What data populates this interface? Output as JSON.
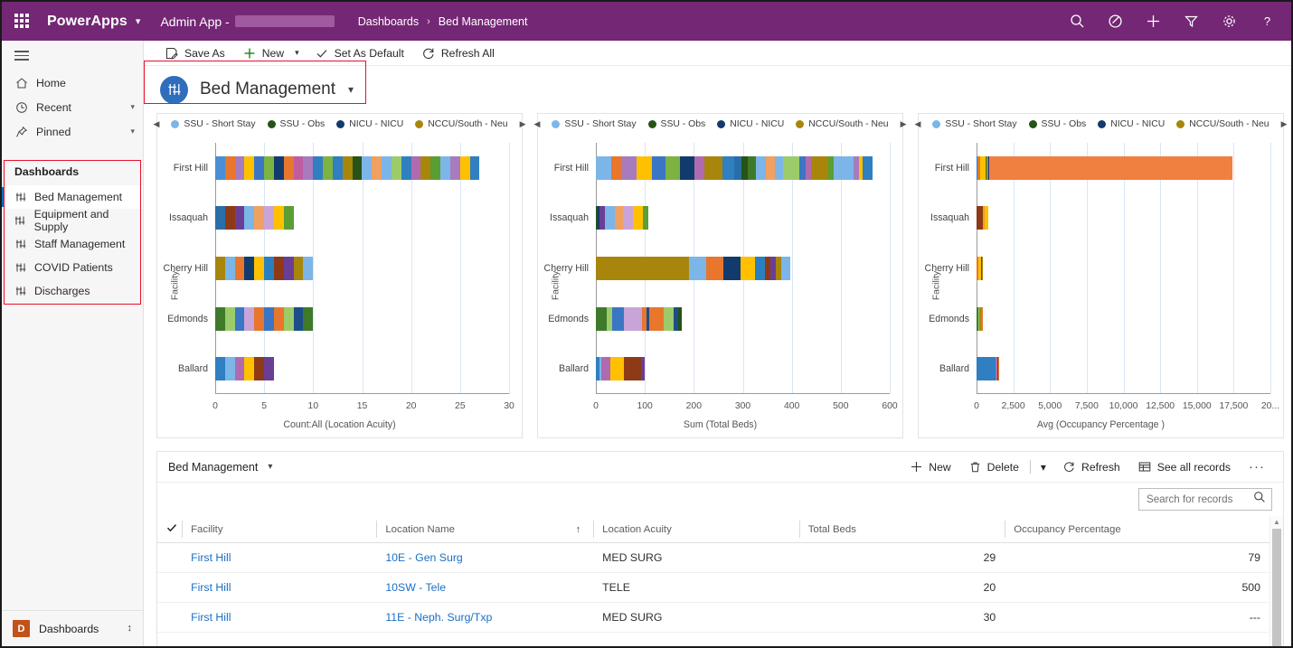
{
  "topbar": {
    "waffle_label": "app-launcher",
    "brand": "PowerApps",
    "app_name": "Admin App -",
    "breadcrumb_root": "Dashboards",
    "breadcrumb_sep": "›",
    "breadcrumb_current": "Bed Management",
    "brand_color": "#742774",
    "icons": [
      "search-icon",
      "edit-circle-icon",
      "plus-icon",
      "filter-icon",
      "gear-icon",
      "help-icon"
    ]
  },
  "commandbar": {
    "save_as": "Save As",
    "new": "New",
    "set_as_default": "Set As Default",
    "refresh_all": "Refresh All"
  },
  "sidebar": {
    "nav": [
      {
        "label": "Home",
        "icon": "home-icon",
        "chevron": false
      },
      {
        "label": "Recent",
        "icon": "clock-icon",
        "chevron": true
      },
      {
        "label": "Pinned",
        "icon": "pin-icon",
        "chevron": true
      }
    ],
    "group_title": "Dashboards",
    "dashboards": [
      {
        "label": "Bed Management",
        "active": true
      },
      {
        "label": "Equipment and Supply",
        "active": false
      },
      {
        "label": "Staff Management",
        "active": false
      },
      {
        "label": "COVID Patients",
        "active": false
      },
      {
        "label": "Discharges",
        "active": false
      }
    ],
    "footer": {
      "badge": "D",
      "label": "Dashboards"
    }
  },
  "dashboard_header": {
    "title": "Bed Management",
    "icon_color": "#2f6dbd"
  },
  "legend": {
    "prev": "◀",
    "next": "▶",
    "items": [
      {
        "label": "SSU - Short Stay",
        "color": "#7cb5e8"
      },
      {
        "label": "SSU - Obs",
        "color": "#275317"
      },
      {
        "label": "NICU - NICU",
        "color": "#123b6d"
      },
      {
        "label": "NCCU/South - Neu",
        "color": "#a8860b"
      }
    ]
  },
  "grid": {
    "title": "Bed Management",
    "toolbar": {
      "new": "New",
      "delete": "Delete",
      "refresh": "Refresh",
      "see_all_records": "See all records",
      "overflow": "···"
    },
    "search": {
      "placeholder": "Search for records",
      "value": ""
    },
    "columns": [
      {
        "label": "Facility",
        "align": "left",
        "width": "17.5%"
      },
      {
        "label": "Location Name",
        "align": "left",
        "width": "19.5%",
        "sorted": true,
        "sort_caret": "↑"
      },
      {
        "label": "Location Acuity",
        "align": "left",
        "width": "18.5%"
      },
      {
        "label": "Total Beds",
        "align": "right",
        "width": "18.5%"
      },
      {
        "label": "Occupancy Percentage",
        "align": "right",
        "width": "23.8%"
      }
    ],
    "rows": [
      {
        "facility": "First Hill",
        "location_name": "10E - Gen Surg",
        "location_acuity": "MED SURG",
        "total_beds": "29",
        "occupancy": "79"
      },
      {
        "facility": "First Hill",
        "location_name": "10SW - Tele",
        "location_acuity": "TELE",
        "total_beds": "20",
        "occupancy": "500"
      },
      {
        "facility": "First Hill",
        "location_name": "11E - Neph. Surg/Txp",
        "location_acuity": "MED SURG",
        "total_beds": "30",
        "occupancy": "---"
      }
    ]
  },
  "annotations": {
    "color": "#e8112d",
    "boxes": [
      "dashboard-title-selector",
      "sidebar-dashboards-group"
    ]
  },
  "chart_data": [
    {
      "type": "bar",
      "orientation": "horizontal",
      "stacked": true,
      "title": "",
      "xlabel": "Count:All (Location Acuity)",
      "ylabel": "Facility",
      "categories": [
        "First Hill",
        "Issaquah",
        "Cherry Hill",
        "Edmonds",
        "Ballard"
      ],
      "values": [
        27,
        8,
        10,
        10,
        6
      ],
      "xlim": [
        0,
        30
      ],
      "xticks": [
        0,
        5,
        10,
        15,
        20,
        25,
        30
      ],
      "xtick_labels": [
        "0",
        "5",
        "10",
        "15",
        "20",
        "25",
        "30"
      ],
      "grid": true,
      "legend_position": "top",
      "segments": [
        [
          [
            "#4a8fd4",
            1
          ],
          [
            "#e8762c",
            1
          ],
          [
            "#a87bbf",
            1
          ],
          [
            "#ffc000",
            1
          ],
          [
            "#3a76c4",
            1
          ],
          [
            "#7cb342",
            1
          ],
          [
            "#123b6d",
            1
          ],
          [
            "#e8762c",
            1
          ],
          [
            "#c05ca0",
            1
          ],
          [
            "#a87bbf",
            1
          ],
          [
            "#2f7fc1",
            1
          ],
          [
            "#7cb342",
            1
          ],
          [
            "#2f7fc1",
            1
          ],
          [
            "#a8860b",
            1
          ],
          [
            "#275317",
            1
          ],
          [
            "#7cb5e8",
            1
          ],
          [
            "#f0a060",
            1
          ],
          [
            "#7cb5e8",
            1
          ],
          [
            "#9ccb6a",
            1
          ],
          [
            "#2f7fc1",
            1
          ],
          [
            "#b06bb0",
            1
          ],
          [
            "#a8860b",
            1
          ],
          [
            "#5a9e34",
            1
          ],
          [
            "#7cb5e8",
            1
          ],
          [
            "#a87bbf",
            1
          ],
          [
            "#ffc000",
            1
          ],
          [
            "#2f7fc1",
            1
          ]
        ],
        [
          [
            "#2a6ea8",
            1
          ],
          [
            "#8f3a16",
            1
          ],
          [
            "#6b3e96",
            1
          ],
          [
            "#7cb5e8",
            1
          ],
          [
            "#f0a060",
            1
          ],
          [
            "#c8a4d8",
            1
          ],
          [
            "#ffc000",
            1
          ],
          [
            "#5a9e34",
            1
          ]
        ],
        [
          [
            "#a8860b",
            1
          ],
          [
            "#7cb5e8",
            1
          ],
          [
            "#e8762c",
            1
          ],
          [
            "#123b6d",
            1
          ],
          [
            "#ffc000",
            1
          ],
          [
            "#2a7fc1",
            1
          ],
          [
            "#8f3a16",
            1
          ],
          [
            "#6b3e96",
            1
          ],
          [
            "#a8860b",
            1
          ],
          [
            "#7cb5e8",
            1
          ]
        ],
        [
          [
            "#3f7a2a",
            1
          ],
          [
            "#9ccb6a",
            1
          ],
          [
            "#3a76c4",
            1
          ],
          [
            "#c8a4d8",
            1
          ],
          [
            "#e8762c",
            1
          ],
          [
            "#3a76c4",
            1
          ],
          [
            "#e8762c",
            1
          ],
          [
            "#9ccb6a",
            1
          ],
          [
            "#1c4e8a",
            1
          ],
          [
            "#3f7a2a",
            1
          ]
        ],
        [
          [
            "#2f7fc1",
            1
          ],
          [
            "#7cb5e8",
            1
          ],
          [
            "#b06bb0",
            1
          ],
          [
            "#ffc000",
            1
          ],
          [
            "#8f3a16",
            1
          ],
          [
            "#6b3e96",
            1
          ]
        ]
      ]
    },
    {
      "type": "bar",
      "orientation": "horizontal",
      "stacked": true,
      "title": "",
      "xlabel": "Sum (Total Beds)",
      "ylabel": "Facility",
      "categories": [
        "First Hill",
        "Issaquah",
        "Cherry Hill",
        "Edmonds",
        "Ballard"
      ],
      "values": [
        565,
        107,
        397,
        175,
        100
      ],
      "xlim": [
        0,
        600
      ],
      "xticks": [
        0,
        100,
        200,
        300,
        400,
        500,
        600
      ],
      "xtick_labels": [
        "0",
        "100",
        "200",
        "300",
        "400",
        "500",
        "600"
      ],
      "grid": true,
      "legend_position": "top",
      "segments": [
        [
          [
            "#7cb5e8",
            30
          ],
          [
            "#e8762c",
            22
          ],
          [
            "#a87bbf",
            28
          ],
          [
            "#ffc000",
            30
          ],
          [
            "#3a76c4",
            28
          ],
          [
            "#7cb342",
            27
          ],
          [
            "#123b6d",
            30
          ],
          [
            "#b06bb0",
            19
          ],
          [
            "#a8860b",
            36
          ],
          [
            "#2f7fc1",
            22
          ],
          [
            "#2a6ea8",
            14
          ],
          [
            "#275317",
            13
          ],
          [
            "#3f7a2a",
            16
          ],
          [
            "#7cb5e8",
            20
          ],
          [
            "#f0a060",
            18
          ],
          [
            "#7cb5e8",
            16
          ],
          [
            "#9ccb6a",
            31
          ],
          [
            "#3a76c4",
            14
          ],
          [
            "#b06bb0",
            10
          ],
          [
            "#a8860b",
            34
          ],
          [
            "#5a9e34",
            11
          ],
          [
            "#7cb5e8",
            38
          ],
          [
            "#a87bbf",
            12
          ],
          [
            "#ffc000",
            6
          ],
          [
            "#2f7fc1",
            20
          ]
        ],
        [
          [
            "#275317",
            3
          ],
          [
            "#123b6d",
            4
          ],
          [
            "#6b3e96",
            12
          ],
          [
            "#7cb5e8",
            20
          ],
          [
            "#f0a060",
            17
          ],
          [
            "#c8a4d8",
            20
          ],
          [
            "#ffc000",
            21
          ],
          [
            "#5a9e34",
            10
          ]
        ],
        [
          [
            "#a8860b",
            190
          ],
          [
            "#7cb5e8",
            35
          ],
          [
            "#e8762c",
            35
          ],
          [
            "#123b6d",
            35
          ],
          [
            "#ffc000",
            30
          ],
          [
            "#2a7fc1",
            20
          ],
          [
            "#8f3a16",
            12
          ],
          [
            "#6b3e96",
            10
          ],
          [
            "#a8860b",
            12
          ],
          [
            "#7cb5e8",
            18
          ]
        ],
        [
          [
            "#3f7a2a",
            22
          ],
          [
            "#9ccb6a",
            11
          ],
          [
            "#3a76c4",
            25
          ],
          [
            "#c8a4d8",
            37
          ],
          [
            "#e8762c",
            8
          ],
          [
            "#1c4e8a",
            6
          ],
          [
            "#e8762c",
            30
          ],
          [
            "#9ccb6a",
            20
          ],
          [
            "#1c4e8a",
            9
          ],
          [
            "#275317",
            7
          ]
        ],
        [
          [
            "#2f7fc1",
            8
          ],
          [
            "#7cb5e8",
            4
          ],
          [
            "#b06bb0",
            18
          ],
          [
            "#ffc000",
            28
          ],
          [
            "#8f3a16",
            35
          ],
          [
            "#6b3e96",
            7
          ]
        ]
      ]
    },
    {
      "type": "bar",
      "orientation": "horizontal",
      "stacked": true,
      "title": "",
      "xlabel": "Avg (Occupancy Percentage )",
      "ylabel": "Facility",
      "categories": [
        "First Hill",
        "Issaquah",
        "Cherry Hill",
        "Edmonds",
        "Ballard"
      ],
      "values": [
        17400,
        800,
        420,
        440,
        1550
      ],
      "xlim": [
        0,
        20000
      ],
      "xticks": [
        0,
        2500,
        5000,
        7500,
        10000,
        12500,
        15000,
        17500,
        20000
      ],
      "xtick_labels": [
        "0",
        "2,500",
        "5,000",
        "7,500",
        "10,000",
        "12,500",
        "15,000",
        "17,500",
        "20..."
      ],
      "grid": true,
      "legend_position": "top",
      "segments": [
        [
          [
            "#2f7fc1",
            90
          ],
          [
            "#e8762c",
            180
          ],
          [
            "#ffc000",
            330
          ],
          [
            "#3f7a2a",
            60
          ],
          [
            "#a8860b",
            70
          ],
          [
            "#b06bb0",
            50
          ],
          [
            "#123b6d",
            90
          ],
          [
            "#f08040",
            16530
          ]
        ],
        [
          [
            "#8f3a16",
            430
          ],
          [
            "#e8a030",
            130
          ],
          [
            "#ffc000",
            240
          ]
        ],
        [
          [
            "#e8762c",
            150
          ],
          [
            "#ffc000",
            130
          ],
          [
            "#8f3a16",
            80
          ],
          [
            "#a8860b",
            60
          ]
        ],
        [
          [
            "#3f7a2a",
            110
          ],
          [
            "#9ccb6a",
            100
          ],
          [
            "#a8860b",
            90
          ],
          [
            "#e8762c",
            140
          ]
        ],
        [
          [
            "#2f7fc1",
            1280
          ],
          [
            "#b06bb0",
            110
          ],
          [
            "#8f3a16",
            100
          ],
          [
            "#e8762c",
            60
          ]
        ]
      ]
    }
  ]
}
